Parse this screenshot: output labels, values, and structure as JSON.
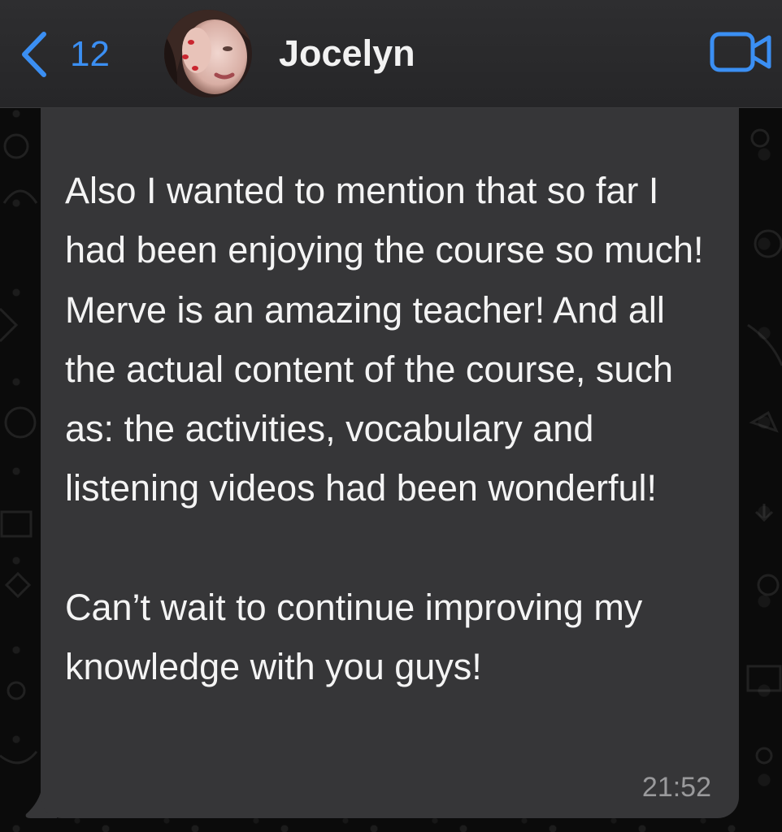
{
  "header": {
    "back_count": "12",
    "contact_name": "Jocelyn",
    "back_icon": "chevron-left-icon",
    "video_icon": "video-camera-icon",
    "accent_color": "#3b8ff3"
  },
  "message": {
    "text": "Also I wanted to mention that so far I had been enjoying the course so much! Merve is an amazing teacher! And all the actual content of the course, such as: the activities, vocabulary and listening videos had been wonderful!\n\nCan’t wait to continue improving my knowledge with you guys!",
    "time": "21:52",
    "bubble_color": "#363638"
  }
}
